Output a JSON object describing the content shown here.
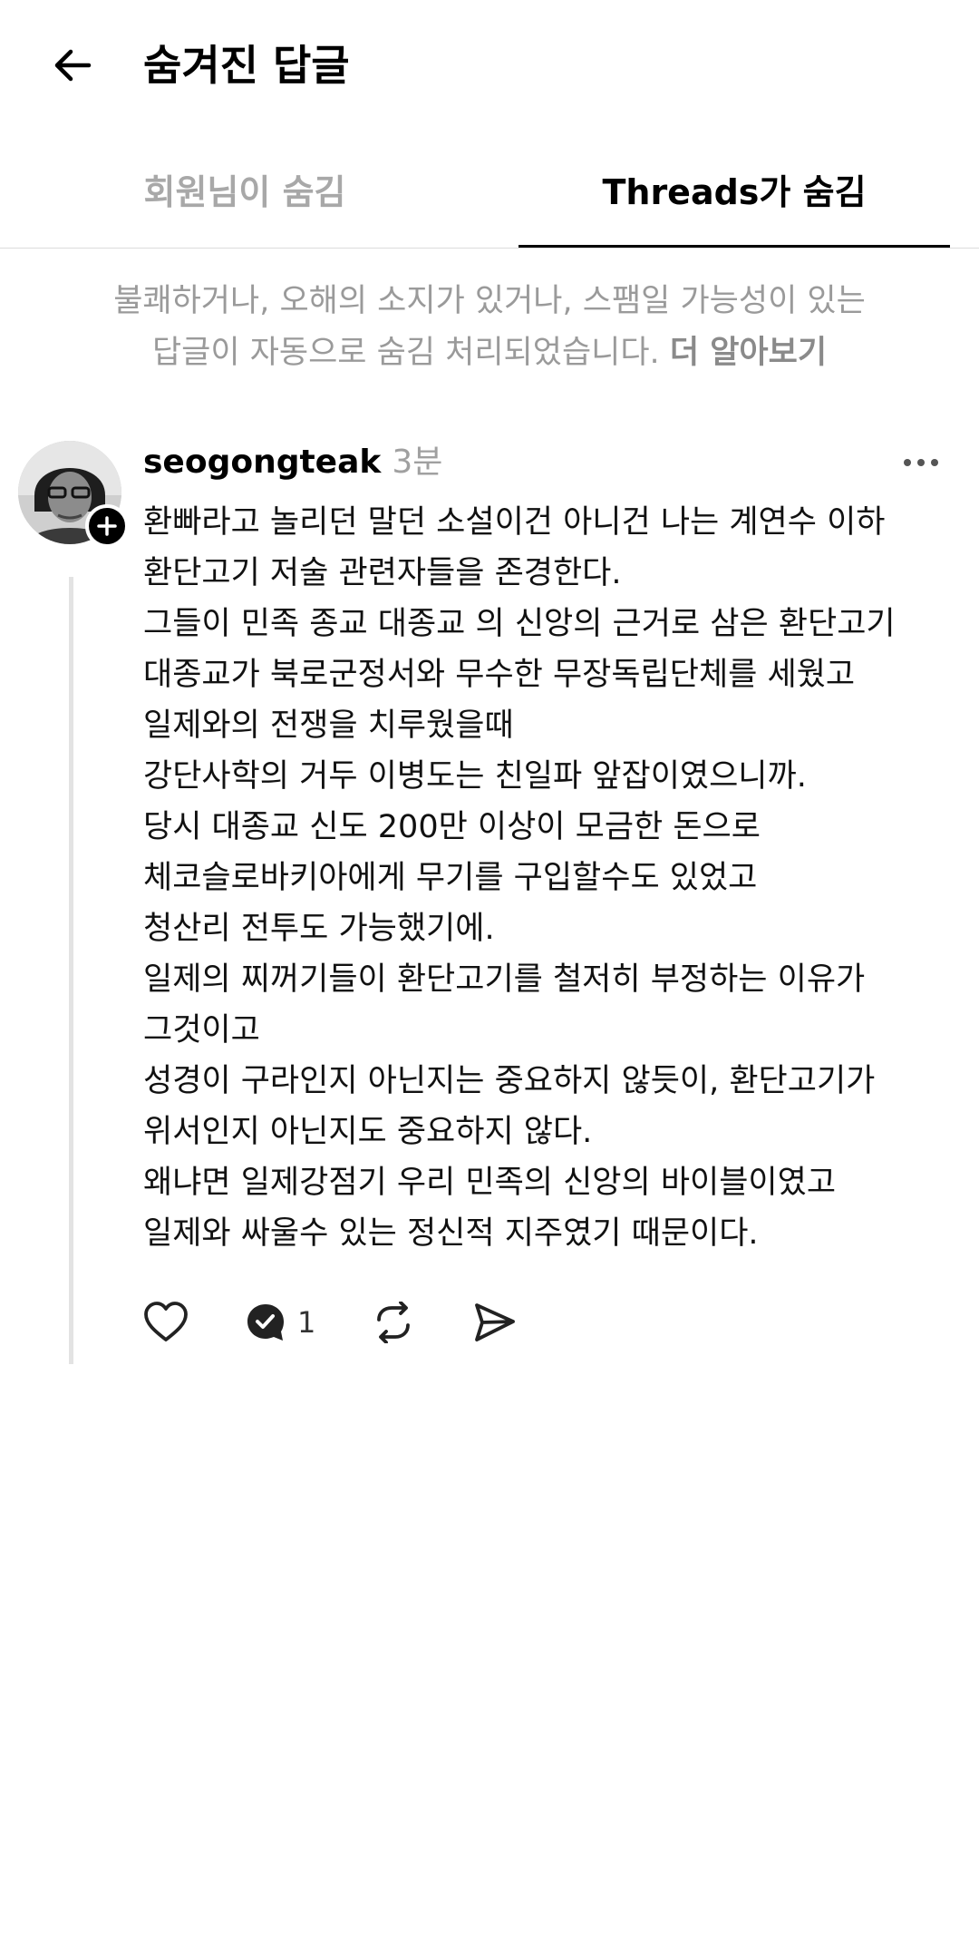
{
  "header": {
    "title": "숨겨진 답글"
  },
  "tabs": [
    {
      "label": "회원님이 숨김",
      "active": false
    },
    {
      "label": "Threads가 숨김",
      "active": true
    }
  ],
  "notice": {
    "line1": "불쾌하거나, 오해의 소지가 있거나, 스팸일 가능성이 있는",
    "line2": "답글이 자동으로 숨김 처리되었습니다.",
    "learn_more": "더 알아보기"
  },
  "post": {
    "username": "seogongteak",
    "time": "3분",
    "lines": [
      "환빠라고 놀리던 말던 소설이건 아니건 나는 계연수 이하",
      "환단고기 저술 관련자들을 존경한다.",
      "그들이 민족 종교 대종교 의 신앙의 근거로 삼은 환단고기",
      "대종교가 북로군정서와 무수한 무장독립단체를 세웠고",
      "일제와의 전쟁을 치루웠을때",
      "강단사학의 거두 이병도는 친일파 앞잡이였으니까.",
      "당시 대종교 신도 200만 이상이 모금한 돈으로",
      "체코슬로바키아에게 무기를 구입할수도 있었고",
      "청산리 전투도 가능했기에.",
      "일제의 찌꺼기들이 환단고기를 철저히 부정하는 이유가",
      "그것이고",
      "성경이 구라인지 아닌지는 중요하지 않듯이, 환단고기가",
      "위서인지 아닌지도 중요하지 않다.",
      "왜냐면 일제강점기 우리 민족의 신앙의 바이블이였고",
      "일제와 싸울수 있는 정신적 지주였기 때문이다."
    ],
    "reply_count": "1"
  },
  "icons": {
    "back": "arrow-left-icon",
    "more": "more-horizontal-icon",
    "like": "heart-icon",
    "reply": "reply-check-icon",
    "repost": "repost-icon",
    "share": "send-icon",
    "follow": "plus-icon"
  }
}
